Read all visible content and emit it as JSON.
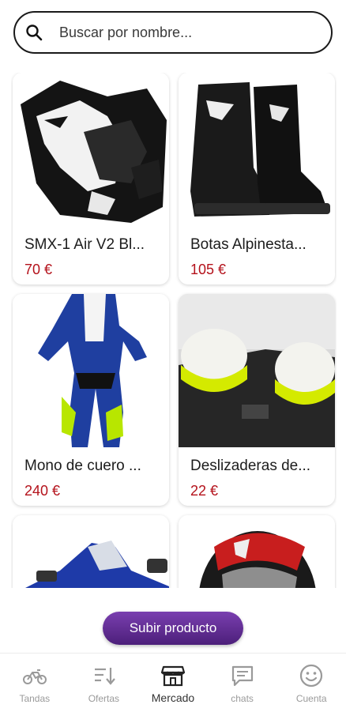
{
  "search": {
    "placeholder": "Buscar por nombre..."
  },
  "products": [
    {
      "title": "SMX-1 Air V2 Bl...",
      "price": "70 €",
      "image": "motorcycle-gloves"
    },
    {
      "title": "Botas Alpinesta...",
      "price": "105 €",
      "image": "motorcycle-boots"
    },
    {
      "title": "Mono de cuero ...",
      "price": "240 €",
      "image": "leather-race-suit"
    },
    {
      "title": "Deslizaderas de...",
      "price": "22 €",
      "image": "knee-sliders"
    },
    {
      "title": "",
      "price": "",
      "image": "sport-motorcycle"
    },
    {
      "title": "",
      "price": "",
      "image": "helmet"
    }
  ],
  "upload_button": {
    "label": "Subir producto"
  },
  "nav": {
    "items": [
      {
        "label": "Tandas",
        "icon": "motorcycle-icon"
      },
      {
        "label": "Ofertas",
        "icon": "sort-icon"
      },
      {
        "label": "Mercado",
        "icon": "store-icon",
        "active": true
      },
      {
        "label": "chats",
        "icon": "chat-icon"
      },
      {
        "label": "Cuenta",
        "icon": "smiley-icon"
      }
    ]
  },
  "colors": {
    "accent": "#5a2a8c",
    "price": "#b4121b"
  }
}
